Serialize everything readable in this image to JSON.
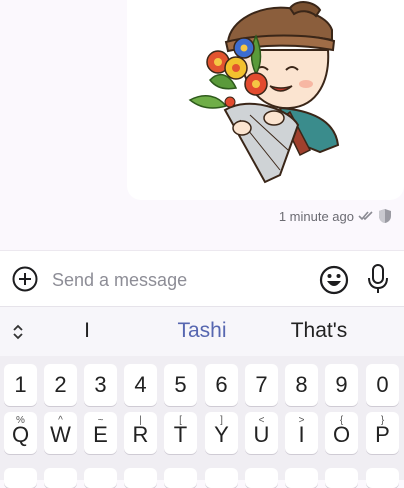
{
  "message": {
    "timestamp": "1 minute ago",
    "icons": [
      "double-check-icon",
      "shield-icon"
    ]
  },
  "composer": {
    "placeholder": "Send a message",
    "icons": [
      "plus-circle-icon",
      "emoji-icon",
      "microphone-icon"
    ]
  },
  "suggestions": {
    "words": [
      "I",
      "Tashi",
      "That's"
    ],
    "icon": "chevron-updown-icon"
  },
  "keyboard": {
    "number_row": [
      "1",
      "2",
      "3",
      "4",
      "5",
      "6",
      "7",
      "8",
      "9",
      "0"
    ],
    "letter_row": [
      {
        "key": "Q",
        "alt": "%"
      },
      {
        "key": "W",
        "alt": "^"
      },
      {
        "key": "E",
        "alt": "~"
      },
      {
        "key": "R",
        "alt": "|"
      },
      {
        "key": "T",
        "alt": "["
      },
      {
        "key": "Y",
        "alt": "]"
      },
      {
        "key": "U",
        "alt": "<"
      },
      {
        "key": "I",
        "alt": ">"
      },
      {
        "key": "O",
        "alt": "{"
      },
      {
        "key": "P",
        "alt": "}"
      }
    ]
  },
  "colors": {
    "background": "#fbf8fd",
    "suggestion_highlight": "#5767b0",
    "meta_text": "#6b6b72"
  }
}
